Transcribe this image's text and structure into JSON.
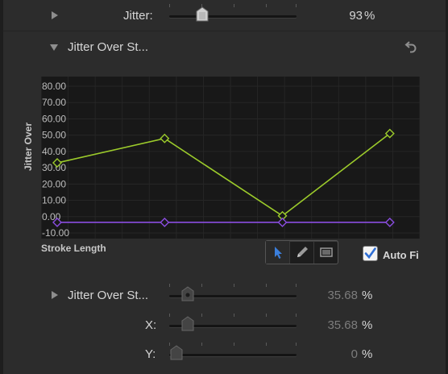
{
  "jitter": {
    "label": "Jitter:",
    "value": "93",
    "unit": "%",
    "percent": 93
  },
  "curve_section": {
    "title": "Jitter Over St..."
  },
  "graph": {
    "ylabel": "Jitter Over",
    "xlabel": "Stroke Length",
    "yticks": [
      "80.00",
      "70.00",
      "60.00",
      "50.00",
      "40.00",
      "30.00",
      "20.00",
      "10.00",
      "0.00",
      "-10.00"
    ]
  },
  "chart_data": {
    "type": "line",
    "ylim": [
      -10,
      80
    ],
    "xlim": [
      0,
      1
    ],
    "ylabel": "Jitter Over",
    "xlabel": "Stroke Length",
    "series": [
      {
        "color": "#9ccb2b",
        "x": [
          0,
          0.31,
          0.65,
          0.96
        ],
        "y": [
          33,
          48,
          0.5,
          51
        ]
      },
      {
        "color": "#8a4de0",
        "x": [
          0,
          0.31,
          0.65,
          0.96
        ],
        "y": [
          -3.5,
          -3.5,
          -3.5,
          -3.5
        ]
      }
    ],
    "grid": true
  },
  "tools": {
    "pointer": "pointer-tool",
    "pen": "pen-tool",
    "rect": "rect-select-tool"
  },
  "autofit": {
    "label": "Auto Fi",
    "checked": true
  },
  "jitter_over_stroke": {
    "label": "Jitter Over St...",
    "value": "35.68",
    "unit": "%",
    "percent": 12
  },
  "x_param": {
    "label": "X:",
    "value": "35.68",
    "unit": "%",
    "percent": 12
  },
  "y_param": {
    "label": "Y:",
    "value": "0",
    "unit": "%",
    "percent": 0
  },
  "colors": {
    "green": "#9ccb2b",
    "purple": "#8a4de0",
    "accent": "#3b7fdc"
  }
}
